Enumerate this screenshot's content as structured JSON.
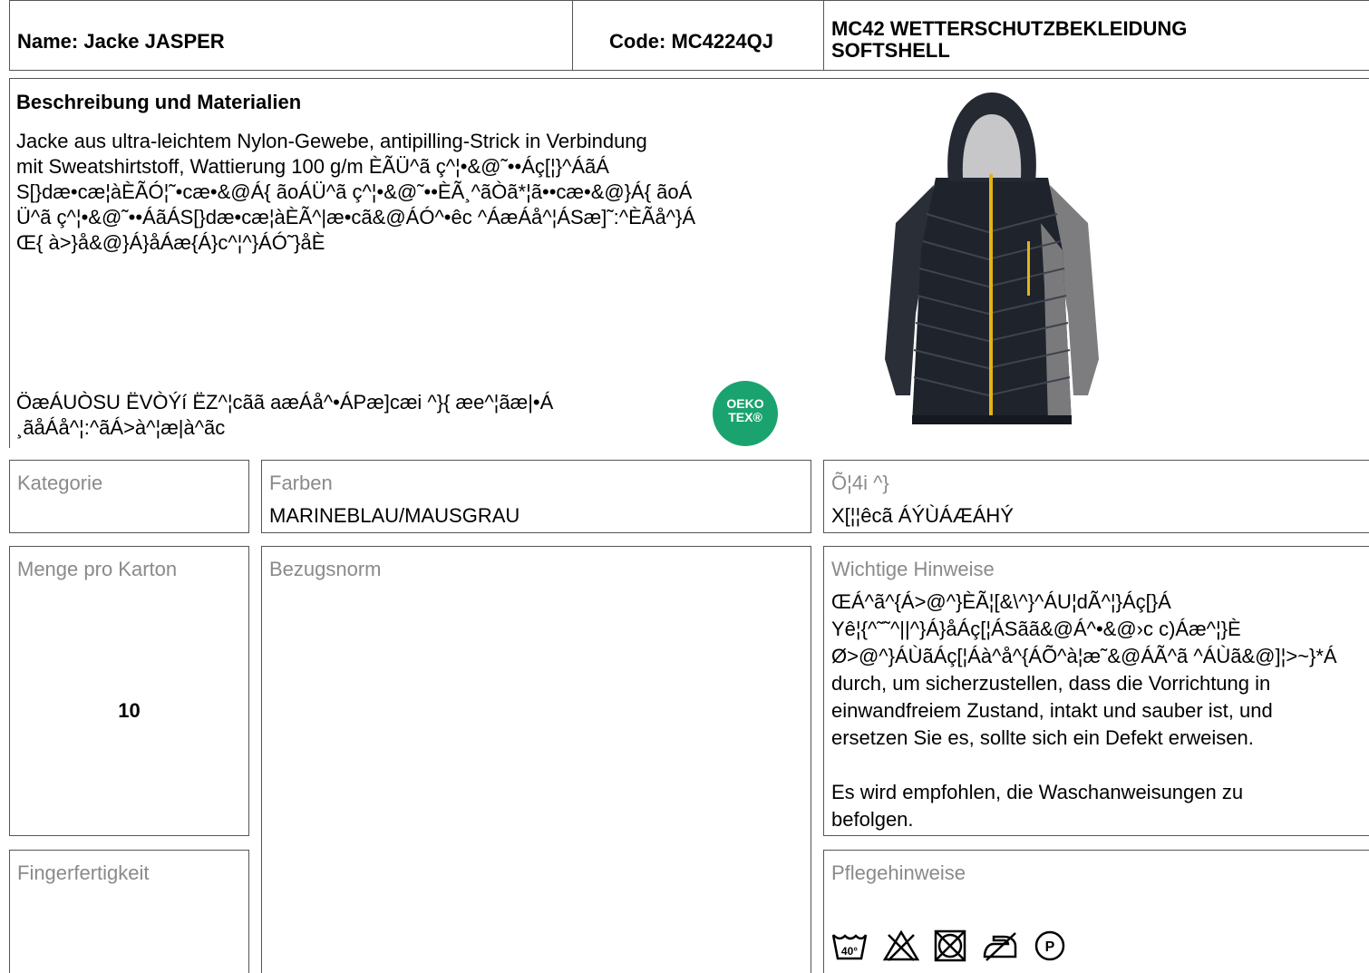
{
  "header": {
    "name": "Name: Jacke JASPER",
    "code": "Code: MC4224QJ",
    "category_title": "MC42 WETTERSCHUTZBEKLEIDUNG\nSOFTSHELL"
  },
  "description": {
    "title": "Beschreibung und Materialien",
    "text": "Jacke aus ultra-leichtem Nylon-Gewebe, antipilling-Strick in Verbindung\nmit Sweatshirtstoff, Wattierung 100 g/m ÈÃÜ^ã ç^¦•&@˜••Áç[¦}^ÁãÁ\nS[}dæ•cæ¦àÈÃÓ¦˜•cæ•&@Á{ ãoÁÜ^ã ç^¦•&@˜••ÈÃ¸^ãÒã*¦ã••cæ•&@}Á{ ãoÁ\nÜ^ã ç^¦•&@˜••ÁãÁS[}dæ•cæ¦àÈÃ^|æ•cã&@ÁÓ^•êc ^ÁæÁå^¦ÁSæ]˜:^ÈÃå^}Á\nŒ{ à>}å&@}Á}åÁæ{Á}c^¦^}ÁÓ˜}åÈ",
    "note": "ÖæÁUÒSU ËVÒÝí ËZ^¦cãã aæÁå^•ÁPæ]cæi ^}{ æe^¦ãæ|•Á\n¸ãåÁå^¦:^ãÁ>à^¦æ|à^ãc"
  },
  "image_alt": "Jacke JASPER",
  "oeko": {
    "line1": "OEKO",
    "line2": "TEX®"
  },
  "fields": {
    "kategorie": {
      "label": "Kategorie",
      "value": ""
    },
    "farben": {
      "label": "Farben",
      "value": "MARINEBLAU/MAUSGRAU"
    },
    "groessen": {
      "label": "Õ¦4i ^}",
      "value": "X[¦¦êcã ÁÝÙÁÆÁHÝ"
    },
    "menge": {
      "label": "Menge pro Karton",
      "value": "10"
    },
    "bezugsnorm": {
      "label": "Bezugsnorm",
      "value": ""
    },
    "hinweise": {
      "label": "Wichtige Hinweise",
      "text": "ŒÁ^ã^{Á>@^}ÈÃ¦[&\\^}^ÁU¦dÃ^¦}Áç[}Á\nYê¦{^˜˜^||^}Á}åÁç[¦ÁSãã&@Á^•&@›c c)Áæ^¦}È\nØ>@^}ÁÙãÁç[¦Áà^å^{ÁÕ^à¦æ˜&@ÁÃ^ã ^ÁÙã&@]¦>~}*Á\ndurch, um sicherzustellen, dass die Vorrichtung in\neinwandfreiem Zustand, intakt und sauber ist, und\nersetzen Sie es, sollte sich ein Defekt erweisen.\n\nEs wird empfohlen, die Waschanweisungen zu\nbefolgen."
    },
    "fingerfertigkeit": {
      "label": "Fingerfertigkeit",
      "value": ""
    },
    "pflege": {
      "label": "Pflegehinweise",
      "wash_temp": "40°"
    }
  },
  "care_icons": [
    "wash-40-icon",
    "no-bleach-icon",
    "no-tumble-dry-icon",
    "no-iron-icon",
    "dry-clean-p-icon"
  ]
}
